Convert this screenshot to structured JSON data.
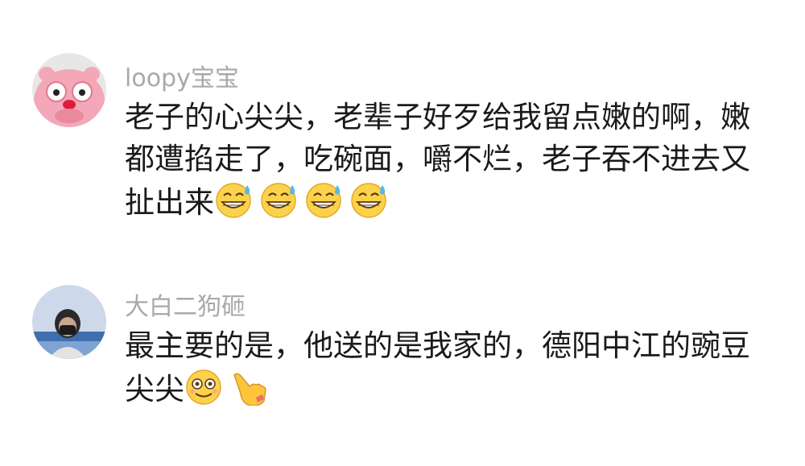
{
  "comments": [
    {
      "username": "loopy宝宝",
      "text": "老子的心尖尖，老辈子好歹给我留点嫩的啊，嫩都遭掐走了，吃碗面，嚼不烂，老子吞不进去又扯出来",
      "emojis": [
        "grin-sweat-icon",
        "grin-sweat-icon",
        "grin-sweat-icon",
        "grin-sweat-icon"
      ]
    },
    {
      "username": "大白二狗砸",
      "text": "最主要的是，他送的是我家的，德阳中江的豌豆尖尖",
      "emojis": [
        "dizzy-face-icon",
        "pointing-hand-icon"
      ]
    }
  ]
}
